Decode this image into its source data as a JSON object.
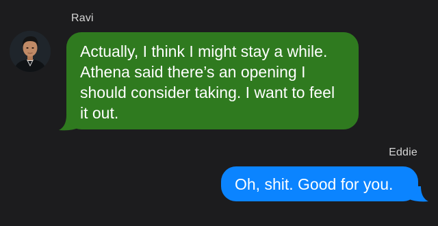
{
  "conversation": {
    "messages": [
      {
        "sender": "Ravi",
        "direction": "incoming",
        "text": "Actually, I think I might stay a while. Athena said there’s an opening I should consider taking. I want to feel it out."
      },
      {
        "sender": "Eddie",
        "direction": "outgoing",
        "text": "Oh, shit. Good for you."
      }
    ]
  },
  "colors": {
    "background": "#1c1c1e",
    "incoming_bubble": "#2f7a1f",
    "outgoing_bubble": "#0b84ff",
    "sender_name": "#d6d6d6"
  }
}
